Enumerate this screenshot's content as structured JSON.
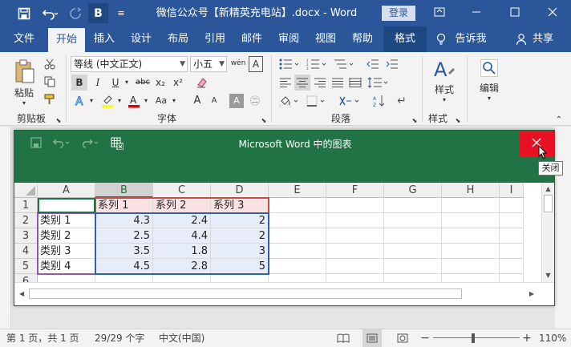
{
  "titlebar": {
    "title": "微信公众号【新精英充电站】.docx  -  Word",
    "login": "登录",
    "qat_bold": "B",
    "qat_more": "≡"
  },
  "tabs": [
    "文件",
    "开始",
    "插入",
    "设计",
    "布局",
    "引用",
    "邮件",
    "审阅",
    "视图",
    "帮助",
    "格式",
    "告诉我",
    "共享"
  ],
  "ribbon": {
    "paste": "粘贴",
    "clipboard_group": "剪贴板",
    "font_name": "等线 (中文正文)",
    "font_size": "小五",
    "wen": "wén",
    "font_group": "字体",
    "paragraph_group": "段落",
    "styles": "样式",
    "styles_group": "样式",
    "editing": "编辑",
    "bold": "B",
    "italic": "I",
    "underline": "U",
    "strike": "abc",
    "sub": "x₂",
    "sup": "x²",
    "grow": "A",
    "shrink": "A",
    "aa": "Aa",
    "a_box": "A",
    "a_char": "A",
    "a_circle": "㊁"
  },
  "dialog": {
    "title": "Microsoft Word 中的图表",
    "tooltip": "关闭",
    "columns": [
      "A",
      "B",
      "C",
      "D",
      "E",
      "F",
      "G",
      "H",
      "I"
    ],
    "rows": [
      "1",
      "2",
      "3",
      "4",
      "5",
      "6"
    ],
    "cells": [
      [
        "",
        "系列 1",
        "系列 2",
        "系列 3"
      ],
      [
        "类别 1",
        "4.3",
        "2.4",
        "2"
      ],
      [
        "类别 2",
        "2.5",
        "4.4",
        "2"
      ],
      [
        "类别 3",
        "3.5",
        "1.8",
        "3"
      ],
      [
        "类别 4",
        "4.5",
        "2.8",
        "5"
      ]
    ]
  },
  "status": {
    "page": "第 1 页，共 1 页",
    "words": "29/29 个字",
    "lang": "中文(中国)",
    "zoom": "110%",
    "minus": "−",
    "plus": "+"
  },
  "colors": {
    "word_blue": "#2b579a",
    "excel_green": "#217346",
    "close_red": "#e81123"
  }
}
